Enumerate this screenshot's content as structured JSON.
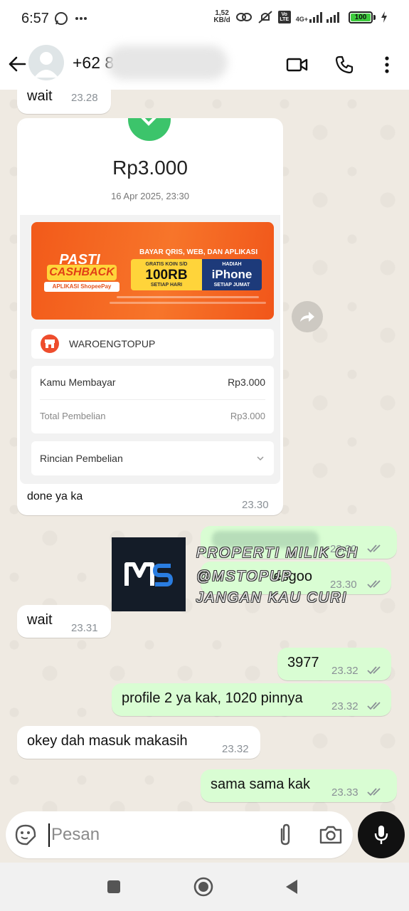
{
  "status_bar": {
    "time": "6:57",
    "speed_value": "1,52",
    "speed_unit": "KB/d",
    "network_badge": "Vo LTE",
    "network_type": "4G+",
    "battery": "100",
    "icons": [
      "whatsapp-icon",
      "more-dots-icon",
      "link-icon",
      "mute-icon",
      "signal-icon",
      "charging-icon"
    ]
  },
  "header": {
    "contact_name": "+62 8",
    "icons": [
      "back-arrow-icon",
      "video-call-icon",
      "phone-icon",
      "more-vert-icon"
    ]
  },
  "messages": [
    {
      "dir": "in",
      "text": "wait",
      "time": "23.28"
    },
    {
      "dir": "in",
      "type": "receipt",
      "amount": "Rp3.000",
      "date": "16 Apr 2025, 23:30",
      "banner": {
        "pasti": "PASTI",
        "cashback": "CASHBACK",
        "aplikasi": "APLIKASI ShopeePay",
        "headline": "BAYAR QRIS, WEB, DAN APLIKASI",
        "yellow_top": "GRATIS KOIN S/D",
        "yellow_main": "100RB",
        "yellow_sub": "SETIAP HARI",
        "blue_top": "HADIAH",
        "blue_main": "iPhone",
        "blue_sub": "SETIAP JUMAT"
      },
      "merchant": "WAROENGTOPUP",
      "paid_label": "Kamu Membayar",
      "paid_value": "Rp3.000",
      "total_label": "Total Pembelian",
      "total_value": "Rp3.000",
      "details_label": "Rincian Pembelian",
      "caption": "done ya ka",
      "time": "23.30"
    },
    {
      "dir": "out",
      "text": "",
      "time": "23.30"
    },
    {
      "dir": "out",
      "text": "lesgoo",
      "time": "23.30"
    },
    {
      "dir": "in",
      "text": "wait",
      "time": "23.31"
    },
    {
      "dir": "out",
      "text": "3977",
      "time": "23.32"
    },
    {
      "dir": "out",
      "text": "profile 2 ya kak, 1020 pinnya",
      "time": "23.32"
    },
    {
      "dir": "in",
      "text": "okey dah masuk makasih",
      "time": "23.32"
    },
    {
      "dir": "out",
      "text": "sama sama kak",
      "time": "23.33"
    }
  ],
  "watermark": {
    "line1": "PROPERTI MILIK CH",
    "line2": "@MSTOPUP",
    "line3": "JANGAN KAU CURI",
    "logo": "mS"
  },
  "composer": {
    "placeholder": "Pesan",
    "icons": [
      "emoji-icon",
      "attach-icon",
      "camera-icon",
      "mic-icon"
    ]
  },
  "navbar": {
    "icons": [
      "recents-square-icon",
      "home-circle-icon",
      "back-triangle-icon"
    ]
  },
  "colors": {
    "chat_bg": "#efeae2",
    "incoming": "#ffffff",
    "outgoing": "#d9fdd3",
    "tick": "#8a9096",
    "mic_btn": "#111111"
  }
}
